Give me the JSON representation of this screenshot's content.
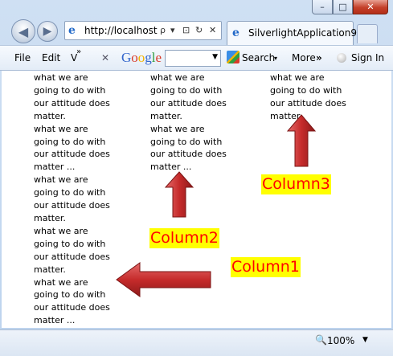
{
  "window": {
    "controls": {
      "minimize": "–",
      "maximize": "□",
      "close": "✕"
    }
  },
  "nav": {
    "back_icon": "◀",
    "forward_icon": "▶",
    "address": "http://localhost",
    "address_icons": {
      "search": "ρ",
      "dropdown": "▾",
      "compat": "⊡",
      "refresh": "↻",
      "stop": "✕"
    },
    "tab_title": "SilverlightApplication9"
  },
  "menu": {
    "file": "File",
    "edit": "Edit",
    "view": "V",
    "more_menus": "»",
    "close_toolbar": "✕",
    "google_letters": [
      "G",
      "o",
      "o",
      "g",
      "l",
      "e"
    ],
    "search_label": "Search",
    "more_label": "More",
    "sign_in_label": "Sign In"
  },
  "content": {
    "column1": [
      "what we are",
      "going to do with",
      "our attitude does",
      "matter.",
      "what we are",
      "going to do with",
      "our attitude does",
      "matter ...",
      "what we are",
      "going to do with",
      "our attitude does",
      "matter.",
      "what we are",
      "going to do with",
      "our attitude does",
      "matter.",
      "what we are",
      "going to do with",
      "our attitude does",
      "matter ..."
    ],
    "column2": [
      "what we are",
      "going to do with",
      "our attitude does",
      "matter.",
      "what we are",
      "going to do with",
      "our attitude does",
      "matter ..."
    ],
    "column3": [
      "what we are",
      "going to do with",
      "our attitude does",
      "matter."
    ],
    "labels": {
      "column1": "Column1",
      "column2": "Column2",
      "column3": "Column3"
    },
    "arrow_color": "#c62b2b",
    "highlight_color": "#ffff00",
    "label_color": "#ff0000"
  },
  "status": {
    "zoom": "100%"
  }
}
